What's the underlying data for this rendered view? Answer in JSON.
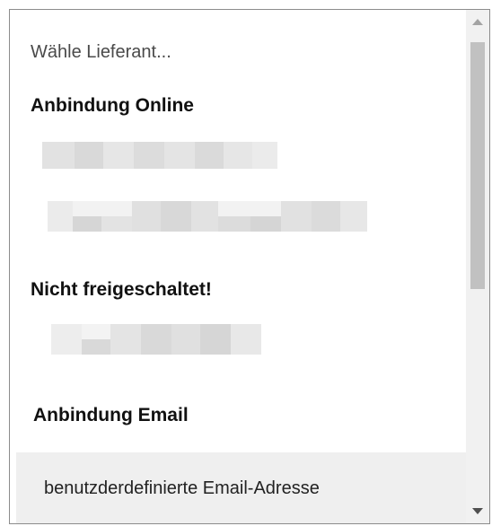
{
  "dropdown": {
    "placeholder": "Wähle Lieferant...",
    "groups": [
      {
        "label": "Anbindung Online"
      },
      {
        "label": "Nicht freigeschaltet!"
      },
      {
        "label": "Anbindung Email"
      }
    ],
    "custom_option": "benutzderdefinierte Email-Adresse"
  },
  "scrollbar": {
    "thumb_position_fraction": 0.0
  }
}
